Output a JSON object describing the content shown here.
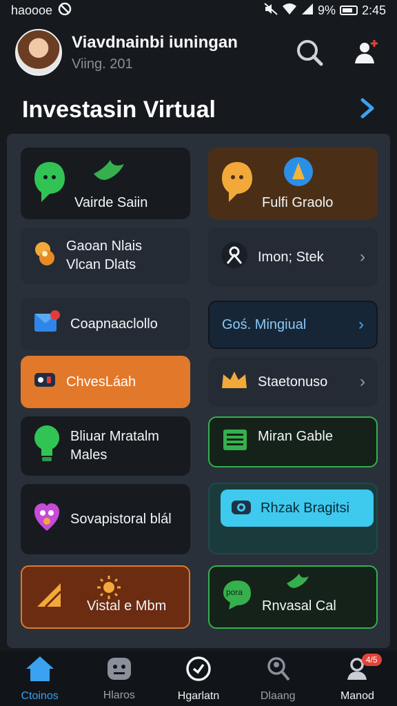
{
  "status_bar": {
    "carrier": "haoooe",
    "clock": "2:45",
    "battery": "9%"
  },
  "header": {
    "user_name": "Viavdnainbi iuningan",
    "user_sub": "Viing. 201",
    "icons": [
      "search-icon",
      "add-user-icon"
    ]
  },
  "title": {
    "text": "Investasin Virtual"
  },
  "cards": [
    {
      "label": "Vairde Saiin",
      "icon": "chat-bubble-icon"
    },
    {
      "label": "Fulfi Graolo",
      "icon": "chat-bubble-icon"
    },
    {
      "label": "Gaoan Nlais Vlcan Dlats",
      "icon": "coins-icon"
    },
    {
      "label": "Imon; Stek",
      "icon": "person-icon"
    },
    {
      "label": "Coapnaaclollo",
      "icon": "mail-icon"
    },
    {
      "label": "Goś. Mingiual",
      "icon": ""
    },
    {
      "label": "ChvesLáah",
      "icon": "toggle-icon"
    },
    {
      "label": "Staetonuso",
      "icon": "crown-icon"
    },
    {
      "label": "Bliuar Mratalm Males",
      "icon": "bulb-icon"
    },
    {
      "label": "Miran Gable",
      "icon": "table-icon"
    },
    {
      "label": "Sovapistoral blál",
      "icon": "heart-face-icon"
    },
    {
      "label": "Rhzak Bragitsi",
      "icon": "camera-icon"
    },
    {
      "label": "Vistal e Mbm",
      "icon": "sun-icon"
    },
    {
      "label": "Rnvasal Cal",
      "icon": "chat-bubble-icon"
    }
  ],
  "cards_extra": {
    "card_12_bubble": "pora"
  },
  "nav": [
    {
      "label": "Ctoinos",
      "icon": "home-icon"
    },
    {
      "label": "Hlaros",
      "icon": "face-icon"
    },
    {
      "label": "Hgarlatn",
      "icon": "clock-icon"
    },
    {
      "label": "Dlaang",
      "icon": "search-person-icon"
    },
    {
      "label": "Manod",
      "icon": "profile-icon",
      "badge": "4/5"
    }
  ],
  "colors": {
    "accent": "#3aa2f0",
    "green": "#35b04d",
    "orange": "#e2782a",
    "cyan": "#3ec9ee"
  }
}
